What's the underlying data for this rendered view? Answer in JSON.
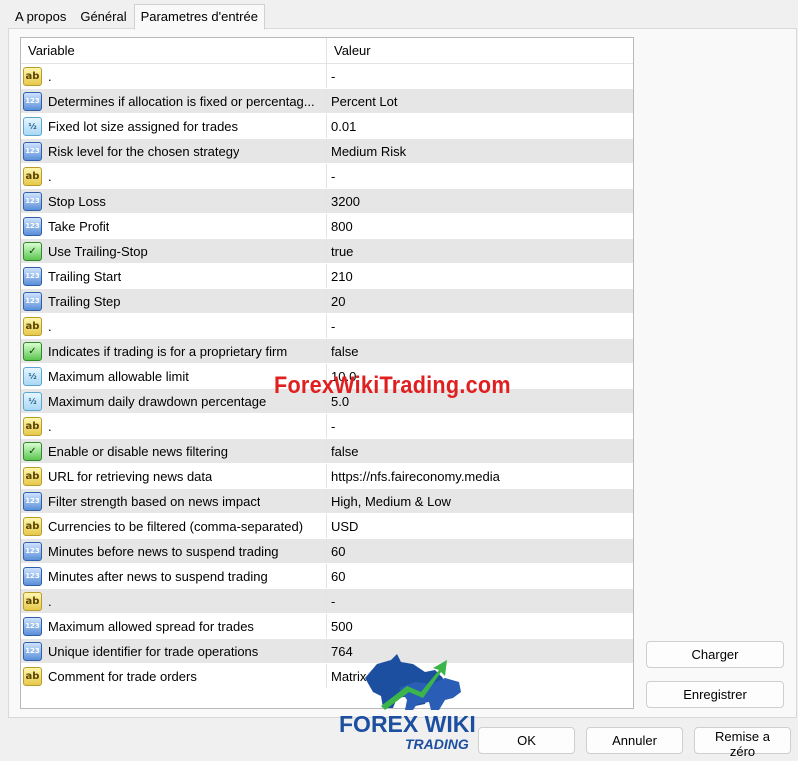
{
  "tabs": [
    "A propos",
    "Général",
    "Parametres d'entrée"
  ],
  "grid": {
    "header": {
      "variable": "Variable",
      "value": "Valeur"
    },
    "rows": [
      {
        "icon": "string-type-icon",
        "variable": ".",
        "value": "-"
      },
      {
        "icon": "integer-type-icon",
        "variable": "Determines if allocation is fixed or percentag...",
        "value": "Percent Lot"
      },
      {
        "icon": "double-type-icon",
        "variable": "Fixed lot size assigned for trades",
        "value": "0.01"
      },
      {
        "icon": "integer-type-icon",
        "variable": "Risk level for the chosen strategy",
        "value": "Medium Risk"
      },
      {
        "icon": "string-type-icon",
        "variable": ".",
        "value": "-"
      },
      {
        "icon": "integer-type-icon",
        "variable": "Stop Loss",
        "value": "3200"
      },
      {
        "icon": "integer-type-icon",
        "variable": "Take Profit",
        "value": "800"
      },
      {
        "icon": "boolean-type-icon",
        "variable": "Use Trailing-Stop",
        "value": "true"
      },
      {
        "icon": "integer-type-icon",
        "variable": "Trailing Start",
        "value": "210"
      },
      {
        "icon": "integer-type-icon",
        "variable": "Trailing Step",
        "value": "20"
      },
      {
        "icon": "string-type-icon",
        "variable": ".",
        "value": "-"
      },
      {
        "icon": "boolean-type-icon",
        "variable": "Indicates if trading is for a proprietary firm",
        "value": "false"
      },
      {
        "icon": "double-type-icon",
        "variable": "Maximum allowable limit",
        "value": "10.0"
      },
      {
        "icon": "double-type-icon",
        "variable": "Maximum daily drawdown percentage",
        "value": "5.0"
      },
      {
        "icon": "string-type-icon",
        "variable": ".",
        "value": "-"
      },
      {
        "icon": "boolean-type-icon",
        "variable": "Enable or disable news filtering",
        "value": "false"
      },
      {
        "icon": "string-type-icon",
        "variable": "URL for retrieving news data",
        "value": "https://nfs.faireconomy.media"
      },
      {
        "icon": "integer-type-icon",
        "variable": "Filter strength based on news impact",
        "value": "High, Medium & Low"
      },
      {
        "icon": "string-type-icon",
        "variable": "Currencies to be filtered (comma-separated)",
        "value": "USD"
      },
      {
        "icon": "integer-type-icon",
        "variable": "Minutes before news to suspend trading",
        "value": "60"
      },
      {
        "icon": "integer-type-icon",
        "variable": "Minutes after news to suspend trading",
        "value": "60"
      },
      {
        "icon": "string-type-icon",
        "variable": ".",
        "value": "-"
      },
      {
        "icon": "integer-type-icon",
        "variable": "Maximum allowed spread for trades",
        "value": "500"
      },
      {
        "icon": "integer-type-icon",
        "variable": "Unique identifier for trade operations",
        "value": "764"
      },
      {
        "icon": "string-type-icon",
        "variable": "Comment for trade orders",
        "value": "Matrix M"
      }
    ]
  },
  "buttons": {
    "load": "Charger",
    "save": "Enregistrer",
    "ok": "OK",
    "cancel": "Annuler",
    "reset": "Remise a zéro"
  },
  "watermark": {
    "text": "ForexWikiTrading.com",
    "logo_line1": "FOREX WIKI",
    "logo_line2": "TRADING"
  },
  "icon_glyphs": {
    "string-type-icon": "ab",
    "integer-type-icon": "123",
    "double-type-icon": "½",
    "boolean-type-icon": "✓"
  },
  "colors": {
    "row_alt": "#e6e6e6",
    "watermark_red": "#e02020",
    "logo_blue": "#1d4fa0",
    "logo_green": "#3bb54a"
  }
}
